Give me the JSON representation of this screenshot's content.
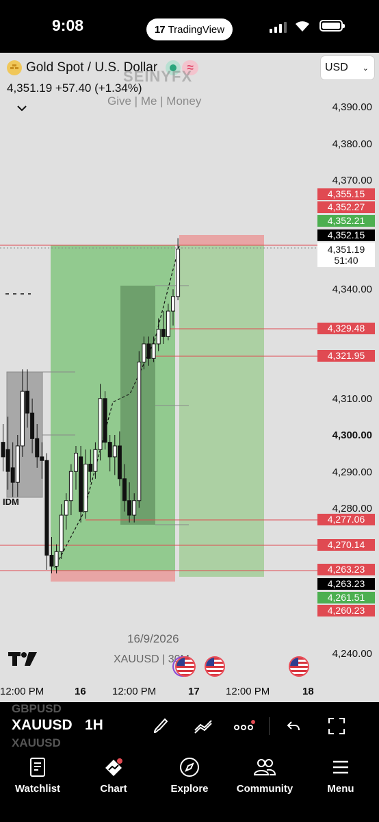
{
  "status_bar": {
    "time": "9:08",
    "app_pill": "TradingView"
  },
  "chart_header": {
    "symbol_name": "Gold Spot / U.S. Dollar",
    "price_line": "4,351.19  +57.40 (+1.34%)",
    "watermark": "SEINYFX",
    "tagline": "Give | Me | Money",
    "currency": "USD"
  },
  "price_axis": [
    "4,390.00",
    "4,380.00",
    "4,370.00",
    "4,340.00",
    "4,310.00",
    "4,300.00",
    "4,290.00",
    "4,280.00",
    "4,240.00"
  ],
  "price_tags": [
    {
      "text": "4,355.15",
      "color": "red"
    },
    {
      "text": "4,352.27",
      "color": "red"
    },
    {
      "text": "4,352.21",
      "color": "green"
    },
    {
      "text": "4,352.15",
      "color": "black"
    },
    {
      "text": "4,351.19",
      "sub": "51:40",
      "color": "white"
    },
    {
      "text": "4,329.48",
      "color": "red"
    },
    {
      "text": "4,321.95",
      "color": "red"
    },
    {
      "text": "4,277.06",
      "color": "red"
    },
    {
      "text": "4,270.14",
      "color": "red"
    },
    {
      "text": "4,263.23",
      "color": "red"
    },
    {
      "text": "4,263.23",
      "color": "black"
    },
    {
      "text": "4,261.51",
      "color": "green"
    },
    {
      "text": "4,260.23",
      "color": "red"
    }
  ],
  "time_axis": [
    "12:00 PM",
    "16",
    "12:00 PM",
    "17",
    "12:00 PM",
    "18"
  ],
  "chart_labels": {
    "date": "16/9/2026",
    "symbol_interval": "XAUUSD | 30M",
    "idm": "IDM"
  },
  "toolbar": {
    "ghost_symbol": "GBPUSD",
    "ghost_symbol_2": "XAUUSD",
    "symbol": "XAUUSD",
    "interval": "1H"
  },
  "nav": {
    "watchlist": "Watchlist",
    "chart": "Chart",
    "explore": "Explore",
    "community": "Community",
    "menu": "Menu"
  },
  "chart_data": {
    "type": "candlestick",
    "title": "Gold Spot / U.S. Dollar",
    "currency": "USD",
    "ylim": [
      4230,
      4397
    ],
    "candles": [
      {
        "o": 4298,
        "h": 4303,
        "l": 4290,
        "c": 4294
      },
      {
        "o": 4296,
        "h": 4305,
        "l": 4285,
        "c": 4290
      },
      {
        "o": 4291,
        "h": 4298,
        "l": 4283,
        "c": 4287
      },
      {
        "o": 4287,
        "h": 4300,
        "l": 4283,
        "c": 4297
      },
      {
        "o": 4297,
        "h": 4318,
        "l": 4294,
        "c": 4312
      },
      {
        "o": 4312,
        "h": 4318,
        "l": 4302,
        "c": 4306
      },
      {
        "o": 4306,
        "h": 4310,
        "l": 4295,
        "c": 4299
      },
      {
        "o": 4299,
        "h": 4303,
        "l": 4291,
        "c": 4294
      },
      {
        "o": 4294,
        "h": 4298,
        "l": 4288,
        "c": 4293
      },
      {
        "o": 4293,
        "h": 4295,
        "l": 4263,
        "c": 4267
      },
      {
        "o": 4267,
        "h": 4272,
        "l": 4262,
        "c": 4264
      },
      {
        "o": 4264,
        "h": 4270,
        "l": 4262,
        "c": 4268
      },
      {
        "o": 4268,
        "h": 4281,
        "l": 4266,
        "c": 4278
      },
      {
        "o": 4278,
        "h": 4284,
        "l": 4274,
        "c": 4282
      },
      {
        "o": 4282,
        "h": 4292,
        "l": 4278,
        "c": 4290
      },
      {
        "o": 4290,
        "h": 4297,
        "l": 4285,
        "c": 4295
      },
      {
        "o": 4294,
        "h": 4297,
        "l": 4276,
        "c": 4279
      },
      {
        "o": 4279,
        "h": 4296,
        "l": 4277,
        "c": 4292
      },
      {
        "o": 4292,
        "h": 4296,
        "l": 4287,
        "c": 4290
      },
      {
        "o": 4290,
        "h": 4298,
        "l": 4288,
        "c": 4296
      },
      {
        "o": 4296,
        "h": 4314,
        "l": 4293,
        "c": 4310
      },
      {
        "o": 4310,
        "h": 4312,
        "l": 4296,
        "c": 4298
      },
      {
        "o": 4298,
        "h": 4300,
        "l": 4290,
        "c": 4294
      },
      {
        "o": 4294,
        "h": 4300,
        "l": 4289,
        "c": 4297
      },
      {
        "o": 4297,
        "h": 4301,
        "l": 4286,
        "c": 4288
      },
      {
        "o": 4288,
        "h": 4292,
        "l": 4279,
        "c": 4282
      },
      {
        "o": 4282,
        "h": 4287,
        "l": 4276,
        "c": 4278
      },
      {
        "o": 4278,
        "h": 4284,
        "l": 4276,
        "c": 4282
      },
      {
        "o": 4282,
        "h": 4323,
        "l": 4280,
        "c": 4320
      },
      {
        "o": 4320,
        "h": 4327,
        "l": 4318,
        "c": 4325
      },
      {
        "o": 4325,
        "h": 4327,
        "l": 4319,
        "c": 4321
      },
      {
        "o": 4321,
        "h": 4327,
        "l": 4320,
        "c": 4325
      },
      {
        "o": 4325,
        "h": 4332,
        "l": 4323,
        "c": 4329
      },
      {
        "o": 4329,
        "h": 4334,
        "l": 4325,
        "c": 4327
      },
      {
        "o": 4327,
        "h": 4336,
        "l": 4326,
        "c": 4334
      },
      {
        "o": 4334,
        "h": 4340,
        "l": 4330,
        "c": 4338
      },
      {
        "o": 4338,
        "h": 4354,
        "l": 4337,
        "c": 4351
      }
    ]
  }
}
